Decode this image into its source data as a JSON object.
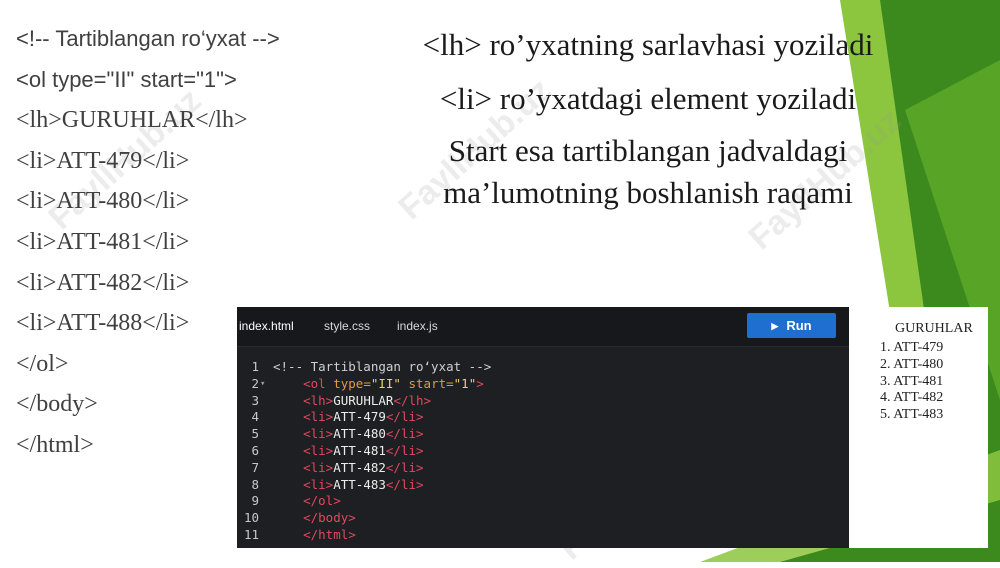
{
  "left_code": [
    "<!-- Tartiblangan ro‘yxat -->",
    "<ol type=\"II\" start=\"1\">",
    "<lh>GURUHLAR</lh>",
    "<li>ATT-479</li>",
    "<li>ATT-480</li>",
    "<li>ATT-481</li>",
    "<li>ATT-482</li>",
    "<li>ATT-488</li>",
    "</ol>",
    "</body>",
    "</html>"
  ],
  "description": {
    "line1": "<lh> ro’yxatning sarlavhasi yoziladi",
    "line2": "<li> ro’yxatdagi element yoziladi",
    "line3": "Start esa tartiblangan jadvaldagi",
    "line4": "ma’lumotning boshlanish raqami"
  },
  "editor": {
    "tabs": [
      "index.html",
      "style.css",
      "index.js"
    ],
    "run_label": "Run",
    "lines": [
      [
        {
          "t": "<!-- Tartiblangan ro‘yxat -->",
          "k": "comment"
        }
      ],
      [
        {
          "t": "    <ol ",
          "k": "tag"
        },
        {
          "t": "type=",
          "k": "attr"
        },
        {
          "t": "\"II\" ",
          "k": "str"
        },
        {
          "t": "start=",
          "k": "attr"
        },
        {
          "t": "\"1\"",
          "k": "str"
        },
        {
          "t": ">",
          "k": "tag"
        }
      ],
      [
        {
          "t": "    <lh>",
          "k": "tag"
        },
        {
          "t": "GURUHLAR",
          "k": "text"
        },
        {
          "t": "</lh>",
          "k": "tag"
        }
      ],
      [
        {
          "t": "    <li>",
          "k": "tag"
        },
        {
          "t": "ATT-479",
          "k": "text"
        },
        {
          "t": "</li>",
          "k": "tag"
        }
      ],
      [
        {
          "t": "    <li>",
          "k": "tag"
        },
        {
          "t": "ATT-480",
          "k": "text"
        },
        {
          "t": "</li>",
          "k": "tag"
        }
      ],
      [
        {
          "t": "    <li>",
          "k": "tag"
        },
        {
          "t": "ATT-481",
          "k": "text"
        },
        {
          "t": "</li>",
          "k": "tag"
        }
      ],
      [
        {
          "t": "    <li>",
          "k": "tag"
        },
        {
          "t": "ATT-482",
          "k": "text"
        },
        {
          "t": "</li>",
          "k": "tag"
        }
      ],
      [
        {
          "t": "    <li>",
          "k": "tag"
        },
        {
          "t": "ATT-483",
          "k": "text"
        },
        {
          "t": "</li>",
          "k": "tag"
        }
      ],
      [
        {
          "t": "    </ol>",
          "k": "tag"
        }
      ],
      [
        {
          "t": "    </body>",
          "k": "tag"
        }
      ],
      [
        {
          "t": "    </html>",
          "k": "tag"
        }
      ]
    ],
    "fold_line": 2,
    "colors": {
      "tag": "#e0485e",
      "attr": "#e59a3b",
      "str": "#f2d25a",
      "comment": "#cfcfcf",
      "text": "#ececec",
      "run_button": "#1f6fd0"
    }
  },
  "preview": {
    "header": "GURUHLAR",
    "items": [
      "1. ATT-479",
      "2. ATT-480",
      "3. ATT-481",
      "4. ATT-482",
      "5. ATT-483"
    ]
  },
  "watermark": "FayllHub.uz",
  "theme": {
    "green_dark": "#3c8a1e",
    "green_light": "#8cc63f",
    "green_mid": "#5aa627"
  }
}
